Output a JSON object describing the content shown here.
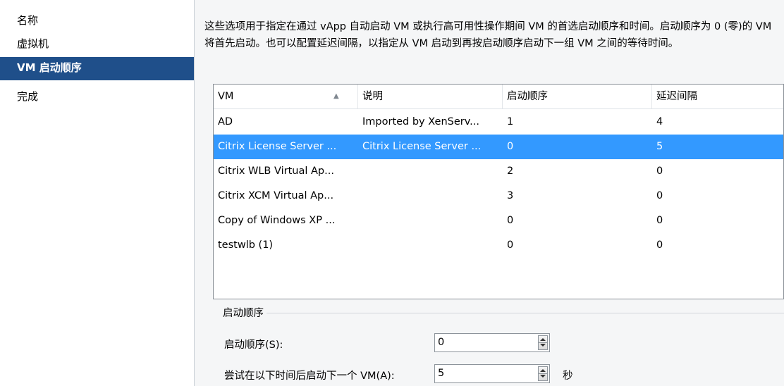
{
  "nav": {
    "items": [
      {
        "label": "名称",
        "selected": false
      },
      {
        "label": "虚拟机",
        "selected": false
      },
      {
        "label": "VM 启动顺序",
        "selected": true
      },
      {
        "label": "完成",
        "selected": false
      }
    ]
  },
  "description": "这些选项用于指定在通过 vApp 自动启动 VM 或执行高可用性操作期间 VM 的首选启动顺序和时间。启动顺序为 0 (零)的 VM 将首先启动。也可以配置延迟间隔，以指定从 VM 启动到再按启动顺序启动下一组 VM 之间的等待时间。",
  "table": {
    "columns": [
      "VM",
      "说明",
      "启动顺序",
      "延迟间隔"
    ],
    "sort_column": "VM",
    "sort_direction": "ascending",
    "rows": [
      {
        "vm": "AD",
        "desc": "Imported by XenServ...",
        "order": "1",
        "delay": "4",
        "selected": false
      },
      {
        "vm": "Citrix License Server ...",
        "desc": "Citrix License Server ...",
        "order": "0",
        "delay": "5",
        "selected": true
      },
      {
        "vm": "Citrix WLB Virtual Ap...",
        "desc": "",
        "order": "2",
        "delay": "0",
        "selected": false
      },
      {
        "vm": "Citrix XCM Virtual Ap...",
        "desc": "",
        "order": "3",
        "delay": "0",
        "selected": false
      },
      {
        "vm": "Copy of Windows XP ...",
        "desc": "",
        "order": "0",
        "delay": "0",
        "selected": false
      },
      {
        "vm": "testwlb (1)",
        "desc": "",
        "order": "0",
        "delay": "0",
        "selected": false
      }
    ]
  },
  "group": {
    "title": "启动顺序",
    "order_label": "启动顺序(S):",
    "order_value": "0",
    "delay_label": "尝试在以下时间后启动下一个 VM(A):",
    "delay_value": "5",
    "delay_unit": "秒"
  },
  "colors": {
    "nav_selected": "#1f4f8a",
    "row_selected": "#3399ff"
  }
}
